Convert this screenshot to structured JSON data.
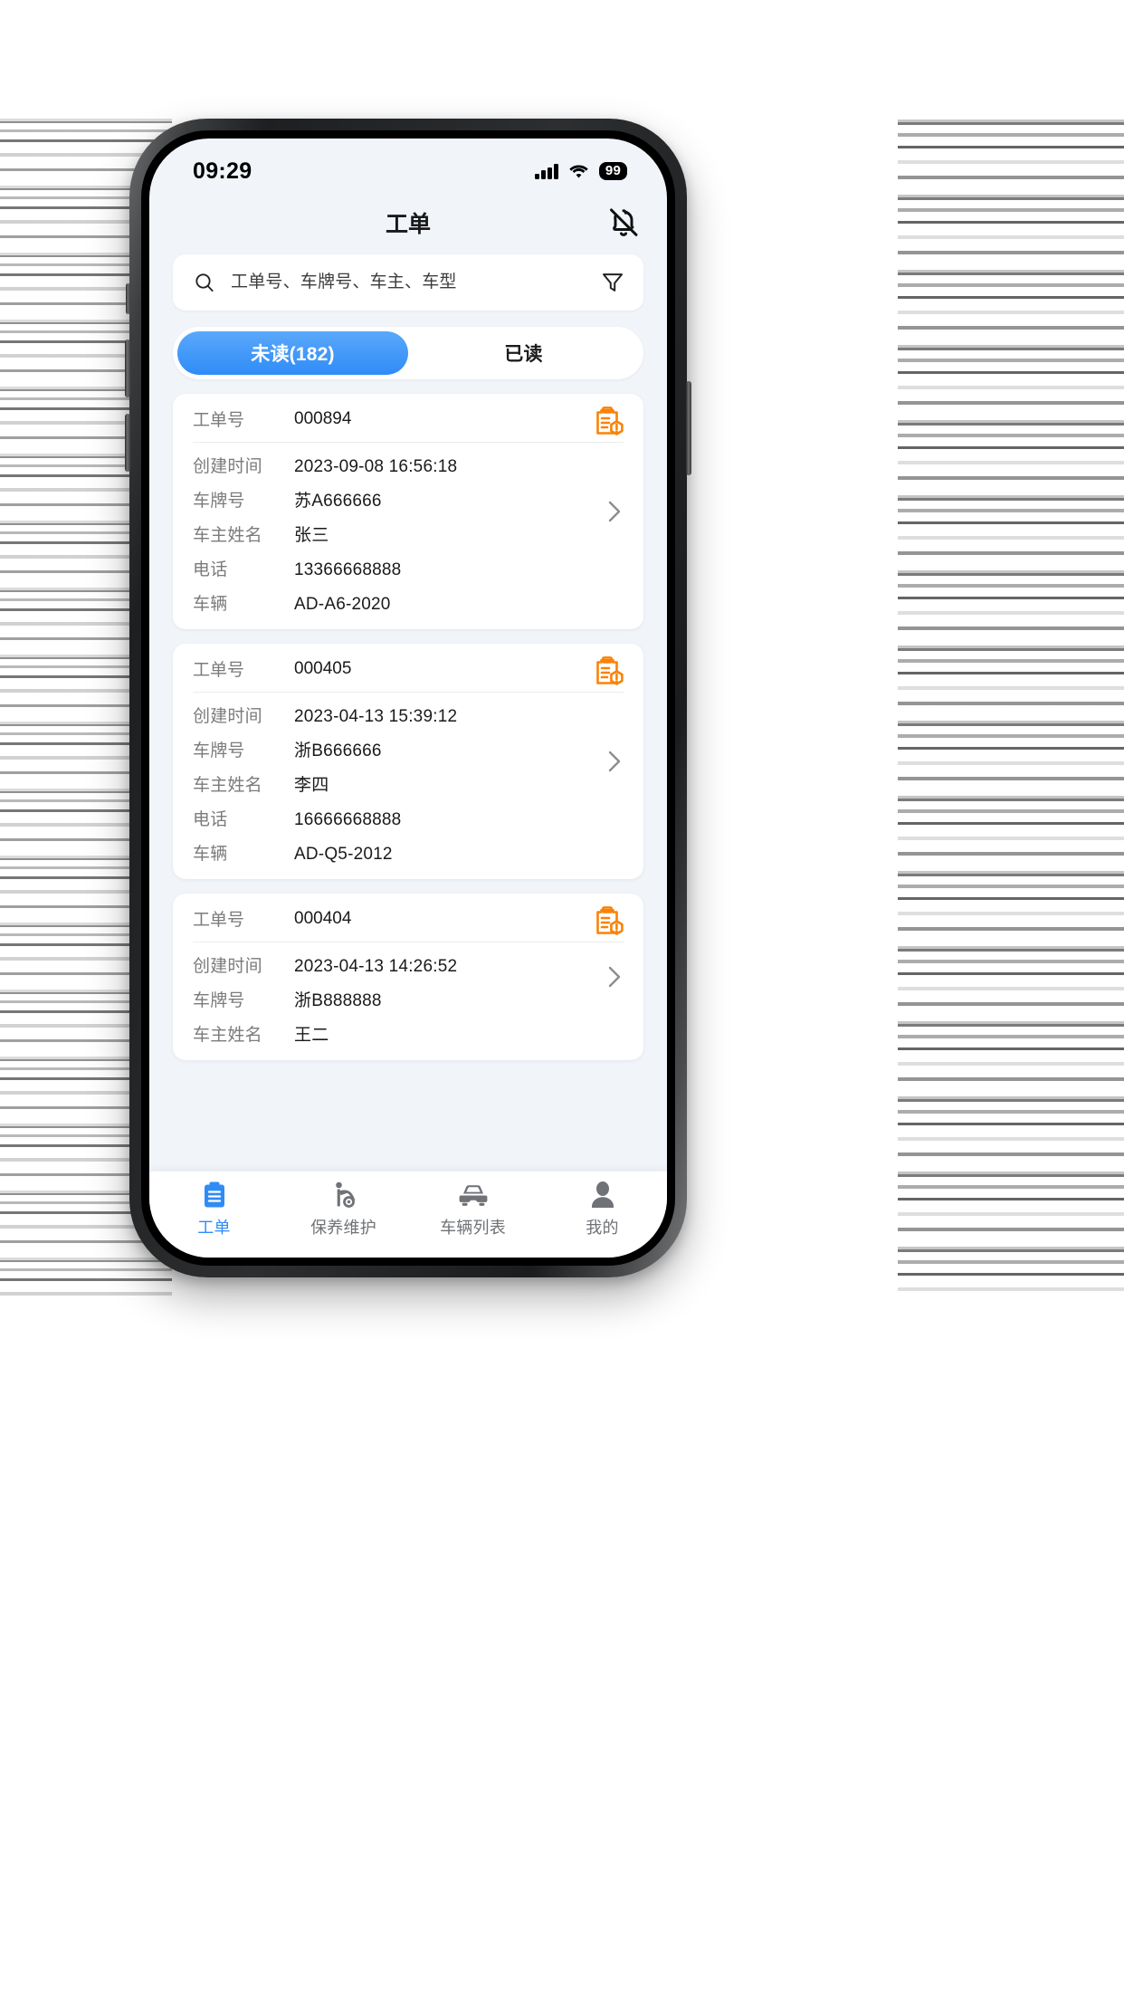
{
  "status_bar": {
    "time": "09:29",
    "battery_level": "99",
    "signal_icon": "signal-bars-icon",
    "wifi_icon": "wifi-icon",
    "battery_icon": "battery-icon"
  },
  "header": {
    "title": "工单",
    "bell_icon": "bell-off-icon"
  },
  "search": {
    "placeholder": "工单号、车牌号、车主、车型",
    "value": "",
    "search_icon": "search-icon",
    "filter_icon": "filter-icon"
  },
  "tabs": [
    {
      "label": "未读(182)",
      "active": true,
      "name": "tab-unread"
    },
    {
      "label": "已读",
      "active": false,
      "name": "tab-read"
    }
  ],
  "field_labels": {
    "order_no": "工单号",
    "created_at": "创建时间",
    "plate_no": "车牌号",
    "owner_name": "车主姓名",
    "phone": "电话",
    "vehicle": "车辆"
  },
  "orders": [
    {
      "order_no": "000894",
      "created_at": "2023-09-08 16:56:18",
      "plate_no": "苏A666666",
      "owner_name": "张三",
      "phone": "13366668888",
      "vehicle": "AD-A6-2020",
      "badge_icon": "clipboard-alert-icon",
      "chevron_icon": "chevron-right-icon"
    },
    {
      "order_no": "000405",
      "created_at": "2023-04-13 15:39:12",
      "plate_no": "浙B666666",
      "owner_name": "李四",
      "phone": "16666668888",
      "vehicle": "AD-Q5-2012",
      "badge_icon": "clipboard-alert-icon",
      "chevron_icon": "chevron-right-icon"
    },
    {
      "order_no": "000404",
      "created_at": "2023-04-13 14:26:52",
      "plate_no": "浙B888888",
      "owner_name": "王二",
      "phone": "",
      "vehicle": "",
      "badge_icon": "clipboard-alert-icon",
      "chevron_icon": "chevron-right-icon"
    }
  ],
  "bottom_nav": [
    {
      "label": "工单",
      "icon": "clipboard-icon",
      "active": true
    },
    {
      "label": "保养维护",
      "icon": "mechanic-icon",
      "active": false
    },
    {
      "label": "车辆列表",
      "icon": "car-icon",
      "active": false
    },
    {
      "label": "我的",
      "icon": "person-icon",
      "active": false
    }
  ],
  "colors": {
    "accent": "#2f8cf7",
    "badge_orange": "#f98308",
    "screen_bg": "#f1f5f9",
    "card_bg": "#ffffff",
    "label_grey": "#7b7b7b"
  }
}
